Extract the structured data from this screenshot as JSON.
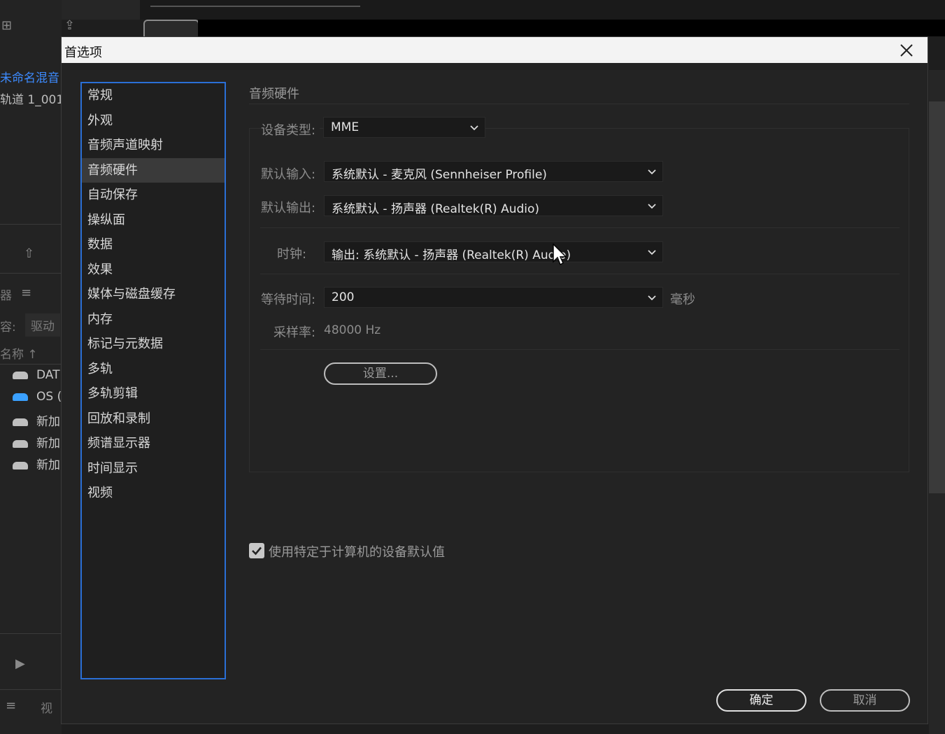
{
  "background": {
    "left_panel": {
      "project_title": "未命名混音",
      "track_item": "轨道 1_001.",
      "panel_tab": "器",
      "filter_label": "容:",
      "filter_value": "驱动",
      "name_column": "名称",
      "drives": [
        "DAT",
        "OS (",
        "新加",
        "新加",
        "新加"
      ],
      "bottom_tab": "视"
    }
  },
  "dialog": {
    "title": "首选项",
    "categories": [
      {
        "label": "常规",
        "selected": false
      },
      {
        "label": "外观",
        "selected": false
      },
      {
        "label": "音频声道映射",
        "selected": false
      },
      {
        "label": "音频硬件",
        "selected": true
      },
      {
        "label": "自动保存",
        "selected": false
      },
      {
        "label": "操纵面",
        "selected": false
      },
      {
        "label": "数据",
        "selected": false
      },
      {
        "label": "效果",
        "selected": false
      },
      {
        "label": "媒体与磁盘缓存",
        "selected": false
      },
      {
        "label": "内存",
        "selected": false
      },
      {
        "label": "标记与元数据",
        "selected": false
      },
      {
        "label": "多轨",
        "selected": false
      },
      {
        "label": "多轨剪辑",
        "selected": false
      },
      {
        "label": "回放和录制",
        "selected": false
      },
      {
        "label": "频谱显示器",
        "selected": false
      },
      {
        "label": "时间显示",
        "selected": false
      },
      {
        "label": "视频",
        "selected": false
      }
    ],
    "section_title": "音频硬件",
    "device_type": {
      "label": "设备类型:",
      "value": "MME"
    },
    "default_input": {
      "label": "默认输入:",
      "value": "系统默认 - 麦克风 (Sennheiser Profile)"
    },
    "default_output": {
      "label": "默认输出:",
      "value": "系统默认 - 扬声器 (Realtek(R) Audio)"
    },
    "clock": {
      "label": "时钟:",
      "value": "输出: 系统默认 - 扬声器 (Realtek(R) Audio)"
    },
    "latency": {
      "label": "等待时间:",
      "value": "200",
      "unit": "毫秒"
    },
    "sample_rate": {
      "label": "采样率:",
      "value": "48000 Hz"
    },
    "settings_button": "设置...",
    "machine_defaults_checkbox": {
      "label": "使用特定于计算机的设备默认值",
      "checked": true
    },
    "ok_button": "确定",
    "cancel_button": "取消"
  }
}
